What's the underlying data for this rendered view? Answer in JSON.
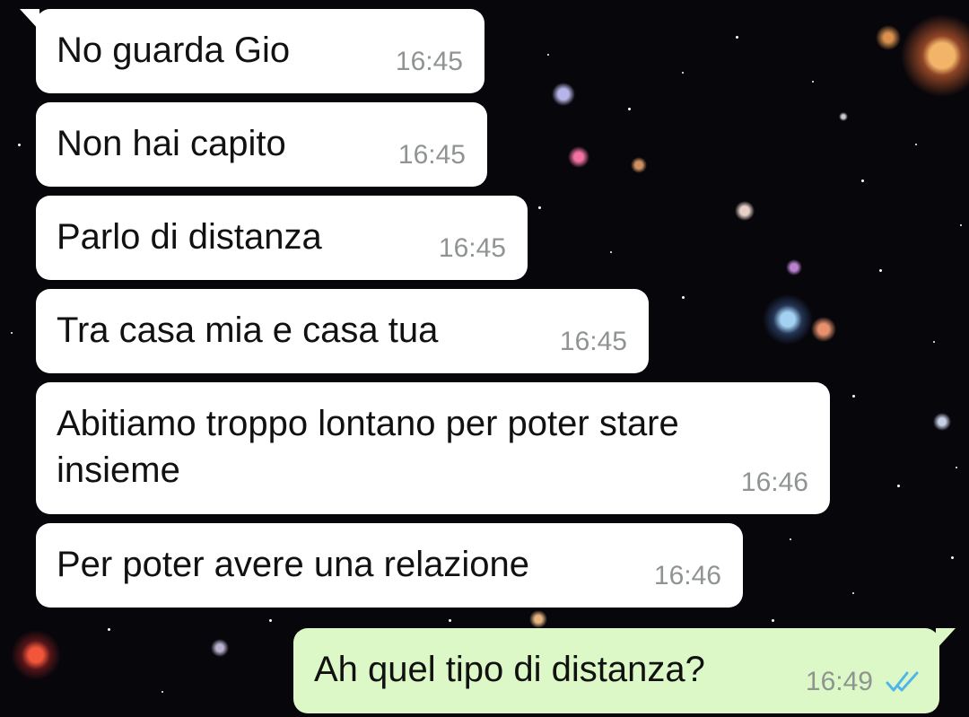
{
  "chat": {
    "messages": [
      {
        "text": "No guarda Gio",
        "time": "16:45",
        "direction": "incoming"
      },
      {
        "text": "Non hai capito",
        "time": "16:45",
        "direction": "incoming"
      },
      {
        "text": "Parlo di distanza",
        "time": "16:45",
        "direction": "incoming"
      },
      {
        "text": "Tra casa mia e casa tua",
        "time": "16:45",
        "direction": "incoming"
      },
      {
        "text": "Abitiamo troppo lontano per poter stare insieme",
        "time": "16:46",
        "direction": "incoming"
      },
      {
        "text": "Per poter avere una relazione",
        "time": "16:46",
        "direction": "incoming"
      },
      {
        "text": "Ah quel tipo di distanza?",
        "time": "16:49",
        "direction": "outgoing",
        "status": "read",
        "status_icon": "double-check-icon"
      }
    ]
  },
  "colors": {
    "incoming_bubble": "#ffffff",
    "outgoing_bubble": "#dcf8c6",
    "timestamp": "#8f9493",
    "read_check": "#4fb6ec",
    "wallpaper": "#07060b"
  },
  "wallpaper": {
    "theme": "deep-space galaxy field"
  }
}
